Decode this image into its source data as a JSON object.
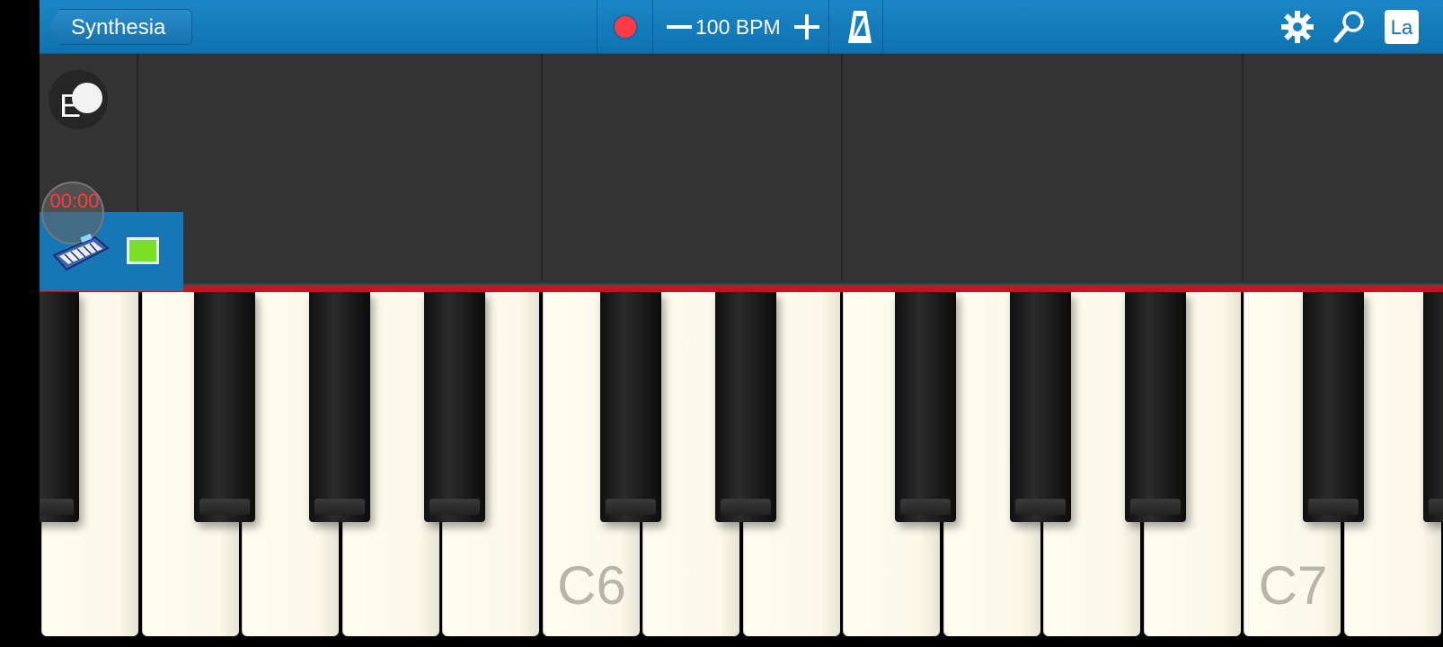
{
  "header": {
    "back_label": "Synthesia",
    "bpm_label": "100 BPM",
    "label_button": "La"
  },
  "left_controls": {
    "toggle_letter": "E",
    "timer": "00:00"
  },
  "keyboard": {
    "white_key_labels": [
      "",
      "",
      "",
      "",
      "",
      "C6",
      "",
      "",
      "",
      "",
      "",
      "",
      "C7",
      ""
    ]
  },
  "colors": {
    "topbar": "#1181c4",
    "record": "#ff3b45",
    "track_color": "#7be024",
    "hit_line": "#b21e22"
  },
  "icons": [
    "record-icon",
    "minus-icon",
    "plus-icon",
    "metronome-icon",
    "gear-icon",
    "search-icon",
    "keyboard-icon"
  ]
}
